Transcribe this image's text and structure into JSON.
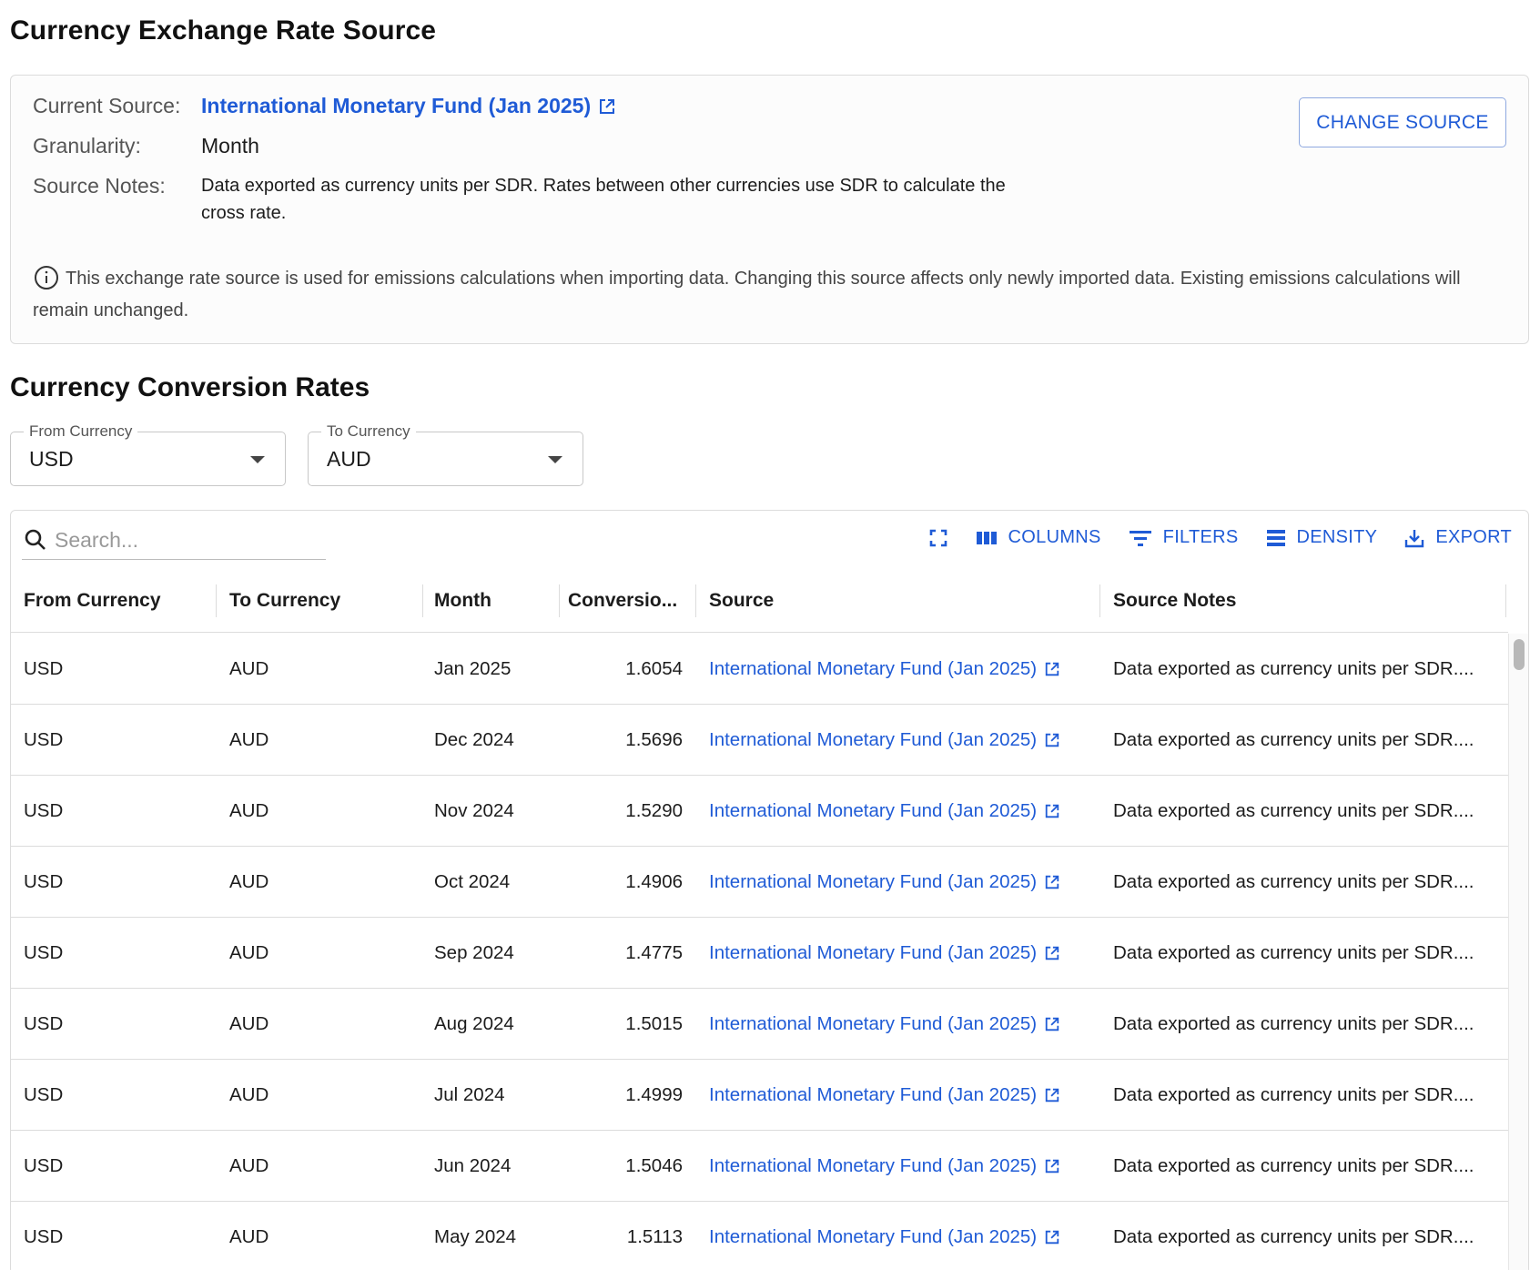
{
  "page": {
    "title": "Currency Exchange Rate Source"
  },
  "source_card": {
    "current_source_label": "Current Source:",
    "current_source_value": "International Monetary Fund (Jan 2025)",
    "granularity_label": "Granularity:",
    "granularity_value": "Month",
    "source_notes_label": "Source Notes:",
    "source_notes_value": "Data exported as currency units per SDR. Rates between other currencies use SDR to calculate the cross rate.",
    "change_source_label": "CHANGE SOURCE",
    "info_text": "This exchange rate source is used for emissions calculations when importing data. Changing this source affects only newly imported data. Existing emissions calculations will remain unchanged."
  },
  "conversion": {
    "title": "Currency Conversion Rates",
    "from_select": {
      "label": "From Currency",
      "value": "USD"
    },
    "to_select": {
      "label": "To Currency",
      "value": "AUD"
    }
  },
  "grid": {
    "search_placeholder": "Search...",
    "toolbar": {
      "columns_label": "COLUMNS",
      "filters_label": "FILTERS",
      "density_label": "DENSITY",
      "export_label": "EXPORT"
    },
    "headers": {
      "from": "From Currency",
      "to": "To Currency",
      "month": "Month",
      "rate": "Conversio...",
      "source": "Source",
      "notes": "Source Notes"
    },
    "rows": [
      {
        "from": "USD",
        "to": "AUD",
        "month": "Jan 2025",
        "rate": "1.6054",
        "source": "International Monetary Fund (Jan 2025)",
        "notes": "Data exported as currency units per SDR...."
      },
      {
        "from": "USD",
        "to": "AUD",
        "month": "Dec 2024",
        "rate": "1.5696",
        "source": "International Monetary Fund (Jan 2025)",
        "notes": "Data exported as currency units per SDR...."
      },
      {
        "from": "USD",
        "to": "AUD",
        "month": "Nov 2024",
        "rate": "1.5290",
        "source": "International Monetary Fund (Jan 2025)",
        "notes": "Data exported as currency units per SDR...."
      },
      {
        "from": "USD",
        "to": "AUD",
        "month": "Oct 2024",
        "rate": "1.4906",
        "source": "International Monetary Fund (Jan 2025)",
        "notes": "Data exported as currency units per SDR...."
      },
      {
        "from": "USD",
        "to": "AUD",
        "month": "Sep 2024",
        "rate": "1.4775",
        "source": "International Monetary Fund (Jan 2025)",
        "notes": "Data exported as currency units per SDR...."
      },
      {
        "from": "USD",
        "to": "AUD",
        "month": "Aug 2024",
        "rate": "1.5015",
        "source": "International Monetary Fund (Jan 2025)",
        "notes": "Data exported as currency units per SDR...."
      },
      {
        "from": "USD",
        "to": "AUD",
        "month": "Jul 2024",
        "rate": "1.4999",
        "source": "International Monetary Fund (Jan 2025)",
        "notes": "Data exported as currency units per SDR...."
      },
      {
        "from": "USD",
        "to": "AUD",
        "month": "Jun 2024",
        "rate": "1.5046",
        "source": "International Monetary Fund (Jan 2025)",
        "notes": "Data exported as currency units per SDR...."
      },
      {
        "from": "USD",
        "to": "AUD",
        "month": "May 2024",
        "rate": "1.5113",
        "source": "International Monetary Fund (Jan 2025)",
        "notes": "Data exported as currency units per SDR...."
      }
    ]
  },
  "colors": {
    "accent": "#1f5bd6",
    "border": "#dcdcdc",
    "text": "#1c1c1c",
    "muted": "#555555"
  },
  "icons": {
    "external_link": "external-link-icon",
    "info": "info-icon",
    "search": "search-icon",
    "fullscreen": "fullscreen-icon",
    "columns": "columns-icon",
    "filters": "filter-icon",
    "density": "density-icon",
    "export": "export-icon"
  }
}
